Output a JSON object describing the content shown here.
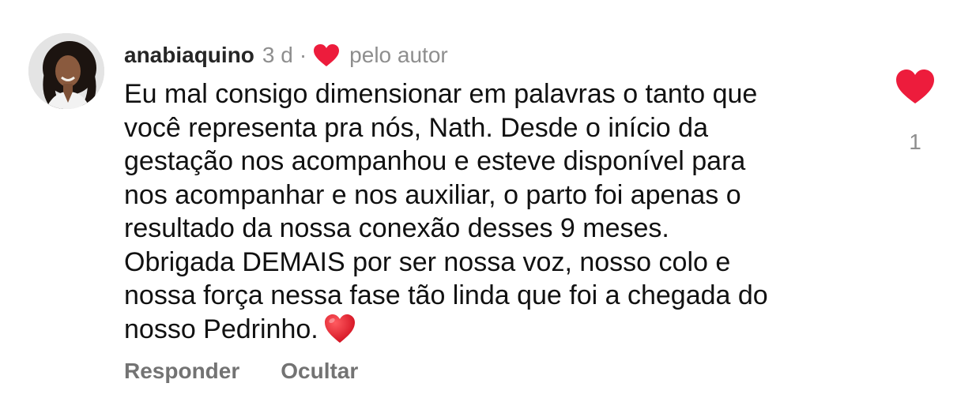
{
  "comment": {
    "username": "anabiaquino",
    "time": "3 d",
    "separator": "·",
    "liked_by_author_label": "pelo autor",
    "body_lines": [
      "Eu mal consigo dimensionar em palavras o tanto que",
      "você representa pra nós, Nath. Desde o início da",
      "gestação nos acompanhou e esteve disponível para",
      "nos acompanhar e nos auxiliar, o parto foi apenas o",
      "resultado da nossa conexão desses 9 meses.",
      "Obrigada DEMAIS por ser nossa voz, nosso colo e",
      "nossa força nessa fase tão linda que foi a chegada do",
      "nosso Pedrinho."
    ],
    "like_count": "1"
  },
  "actions": {
    "reply_label": "Responder",
    "hide_label": "Ocultar"
  },
  "icons": {
    "author_heart": "heart-icon",
    "inline_emoji": "red-heart-emoji",
    "like_button": "heart-filled-icon"
  },
  "colors": {
    "heart": "#ed1c3c",
    "muted_text": "#8e8e8e",
    "action_text": "#737373",
    "username": "#262626"
  }
}
